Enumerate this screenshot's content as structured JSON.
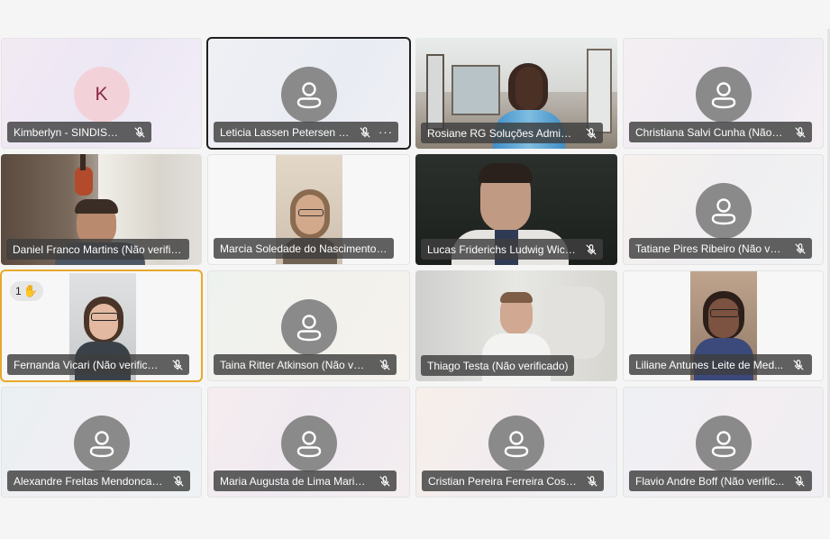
{
  "participants": [
    {
      "name": "Kimberlyn - SINDISPGE",
      "avatar_letter": "K",
      "muted": true
    },
    {
      "name": "Leticia Lassen Petersen (...",
      "muted": true,
      "speaking": true,
      "more_label": "···"
    },
    {
      "name": "Rosiane RG Soluções Adminis...",
      "muted": true,
      "video": true
    },
    {
      "name": "Christiana Salvi Cunha (Não v...",
      "muted": true
    },
    {
      "name": "Daniel Franco Martins (Não verific...",
      "muted": false,
      "video": true
    },
    {
      "name": "Marcia Soledade do Nascimento (...",
      "muted": false,
      "video": true
    },
    {
      "name": "Lucas Friderichs Ludwig Wick...",
      "muted": true,
      "video": true
    },
    {
      "name": "Tatiane Pires Ribeiro (Não ver...",
      "muted": true
    },
    {
      "name": "Fernanda Vicari (Não verifica...",
      "muted": true,
      "video": true,
      "hand_raised": true,
      "hand_count": "1"
    },
    {
      "name": "Taina Ritter Atkinson (Não ver...",
      "muted": true
    },
    {
      "name": "Thiago Testa (Não verificado)",
      "muted": false,
      "video": true
    },
    {
      "name": "Liliane Antunes Leite de Med...",
      "muted": true,
      "video": true
    },
    {
      "name": "Alexandre Freitas Mendonca (...",
      "muted": true
    },
    {
      "name": "Maria Augusta de Lima Maria...",
      "muted": true
    },
    {
      "name": "Cristian Pereira Ferreira Costa...",
      "muted": true
    },
    {
      "name": "Flavio Andre Boff (Não verific...",
      "muted": true
    }
  ],
  "colors": {
    "speaking_border": "#1f1f1f",
    "raised_hand_border": "#e8a92a",
    "avatar_letter_bg": "#f3d1d8"
  }
}
